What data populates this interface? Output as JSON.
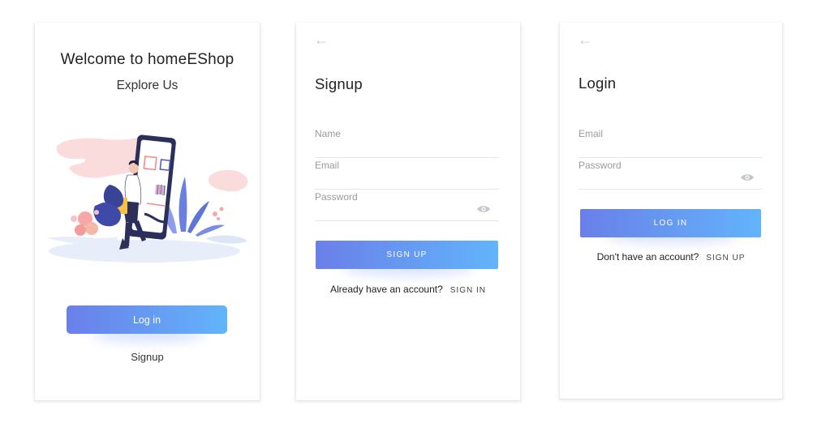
{
  "welcome": {
    "title": "Welcome to homeEShop",
    "subtitle": "Explore Us",
    "login_button": "Log in",
    "signup_link": "Signup",
    "illustration": "shopping-phone-illustration"
  },
  "signup": {
    "back_icon": "back-arrow-icon",
    "title": "Signup",
    "name_placeholder": "Name",
    "email_placeholder": "Email",
    "password_placeholder": "Password",
    "button": "SIGN UP",
    "prompt": "Already have an account?",
    "link": "SIGN IN"
  },
  "login": {
    "back_icon": "back-arrow-icon",
    "title": "Login",
    "email_placeholder": "Email",
    "password_placeholder": "Password",
    "button": "LOG IN",
    "prompt": "Don't have an account?",
    "link": "SIGN UP"
  },
  "colors": {
    "gradient_start": "#6a7fe9",
    "gradient_end": "#62b4fb",
    "text_dark": "#222222",
    "placeholder": "#9a9a9a"
  }
}
